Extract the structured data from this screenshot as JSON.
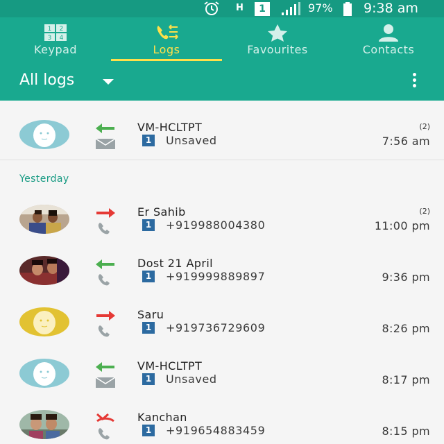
{
  "status_bar": {
    "network_letter": "H",
    "sim_slot": "1",
    "battery_percent": "97%",
    "time": "9:38 am",
    "icons": [
      "alarm-icon",
      "signal-icon",
      "battery-icon"
    ]
  },
  "tabs": [
    {
      "label": "Keypad",
      "icon": "keypad-icon",
      "active": false
    },
    {
      "label": "Logs",
      "icon": "logs-icon",
      "active": true
    },
    {
      "label": "Favourites",
      "icon": "star-icon",
      "active": false
    },
    {
      "label": "Contacts",
      "icon": "person-icon",
      "active": false
    }
  ],
  "filter": {
    "label": "All logs"
  },
  "colors": {
    "accent": "#19a98f",
    "status_bar": "#169a82",
    "active_tab": "#ffe04a",
    "incoming_arrow": "#4caf50",
    "outgoing_arrow": "#e53935",
    "sim_badge": "#2c6aa0"
  },
  "section_header": "Yesterday",
  "logs": [
    {
      "name": "VM-HCLTPT",
      "sim": "1",
      "number": "Unsaved",
      "time": "7:56 am",
      "count": "(2)",
      "direction": "incoming",
      "type": "message",
      "avatar": "default-blue"
    },
    {
      "name": "Er Sahib",
      "sim": "1",
      "number": "+919988004380",
      "time": "11:00 pm",
      "count": "(2)",
      "direction": "outgoing",
      "type": "call",
      "avatar": "photo"
    },
    {
      "name": "Dost 21 April",
      "sim": "1",
      "number": "+919999889897",
      "time": "9:36 pm",
      "count": "",
      "direction": "incoming",
      "type": "call",
      "avatar": "photo"
    },
    {
      "name": "Saru",
      "sim": "1",
      "number": "+919736729609",
      "time": "8:26 pm",
      "count": "",
      "direction": "outgoing",
      "type": "call",
      "avatar": "default-yellow"
    },
    {
      "name": "VM-HCLTPT",
      "sim": "1",
      "number": "Unsaved",
      "time": "8:17 pm",
      "count": "",
      "direction": "incoming",
      "type": "message",
      "avatar": "default-blue"
    },
    {
      "name": "Kanchan",
      "sim": "1",
      "number": "+919654883459",
      "time": "8:15 pm",
      "count": "",
      "direction": "missed",
      "type": "call",
      "avatar": "photo"
    }
  ]
}
